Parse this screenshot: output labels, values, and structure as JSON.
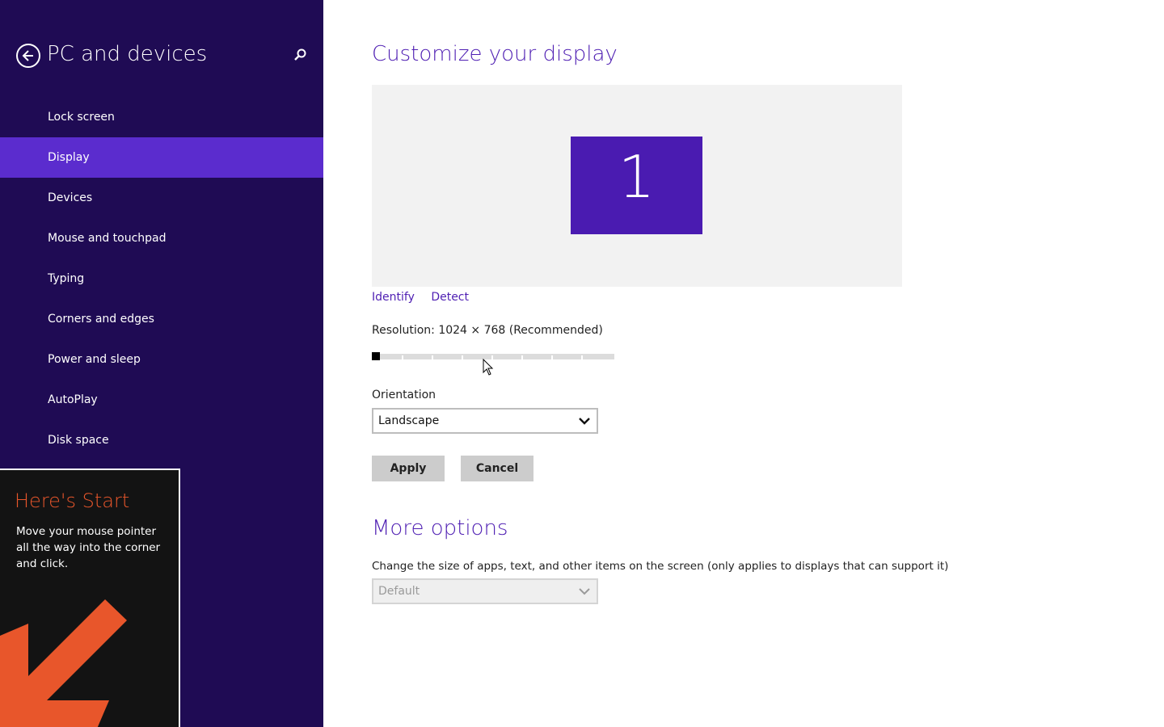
{
  "sidebar": {
    "title": "PC and devices",
    "back_icon": "back-arrow-icon",
    "search_icon": "search-icon",
    "items": [
      {
        "label": "Lock screen"
      },
      {
        "label": "Display",
        "active": true
      },
      {
        "label": "Devices"
      },
      {
        "label": "Mouse and touchpad"
      },
      {
        "label": "Typing"
      },
      {
        "label": "Corners and edges"
      },
      {
        "label": "Power and sleep"
      },
      {
        "label": "AutoPlay"
      },
      {
        "label": "Disk space"
      }
    ],
    "background_color": "#1f0b54",
    "active_color": "#5b2cce"
  },
  "tip": {
    "title": "Here's Start",
    "body": "Move your mouse pointer all the way into the corner and click.",
    "arrow_color": "#e8562b"
  },
  "main": {
    "title": "Customize your display",
    "monitor_number": "1",
    "links": {
      "identify": "Identify",
      "detect": "Detect"
    },
    "resolution_label": "Resolution: 1024 × 768 (Recommended)",
    "resolution_slider": {
      "position": 0,
      "steps": 9
    },
    "orientation": {
      "label": "Orientation",
      "value": "Landscape"
    },
    "buttons": {
      "apply": "Apply",
      "cancel": "Cancel"
    },
    "more_options": {
      "title": "More options",
      "scale_label": "Change the size of apps, text, and other items on the screen (only applies to displays that can support it)",
      "scale_value": "Default"
    },
    "accent_color": "#4f1fb3"
  }
}
